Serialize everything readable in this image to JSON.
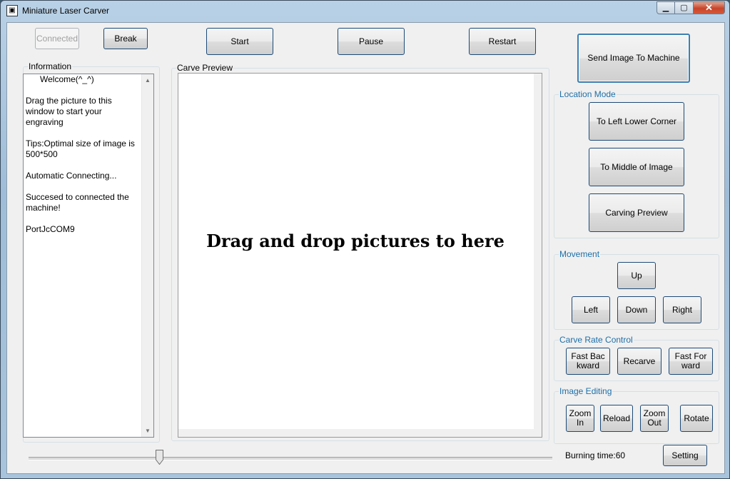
{
  "window": {
    "title": "Miniature Laser Carver",
    "minimize_glyph": "▁",
    "maximize_glyph": "▢",
    "close_glyph": "✕"
  },
  "toolbar": {
    "connected_label": "Connected",
    "break_label": "Break",
    "start_label": "Start",
    "pause_label": "Pause",
    "restart_label": "Restart",
    "send_label": "Send Image To Machine"
  },
  "information": {
    "label": "Information",
    "text": "      Welcome(^_^)\n\nDrag the picture to this window to start your engraving\n\nTips:Optimal size of image is 500*500\n\nAutomatic Connecting...\n\nSuccesed to connected the machine!\n\nPortJcCOM9"
  },
  "preview": {
    "label": "Carve Preview",
    "hint": "Drag and drop pictures to here"
  },
  "location_mode": {
    "label": "Location Mode",
    "left_lower_label": "To Left Lower Corner",
    "middle_label": "To Middle of Image",
    "carving_preview_label": "Carving Preview"
  },
  "movement": {
    "label": "Movement",
    "up_label": "Up",
    "left_label": "Left",
    "down_label": "Down",
    "right_label": "Right"
  },
  "carve_rate": {
    "label": "Carve Rate Control",
    "fast_backward_label": "Fast Bac kward",
    "recarve_label": "Recarve",
    "fast_forward_label": "Fast For ward"
  },
  "image_editing": {
    "label": "Image Editing",
    "zoom_in_label": "Zoom In",
    "reload_label": "Reload",
    "zoom_out_label": "Zoom Out",
    "rotate_label": "Rotate"
  },
  "footer": {
    "burning_time_label": "Burning time:60",
    "setting_label": "Setting",
    "slider_value_fraction": 0.25
  },
  "colors": {
    "group_label_blue": "#1e6fa8",
    "button_border": "#1d4a78",
    "close_button": "#c8442a"
  }
}
